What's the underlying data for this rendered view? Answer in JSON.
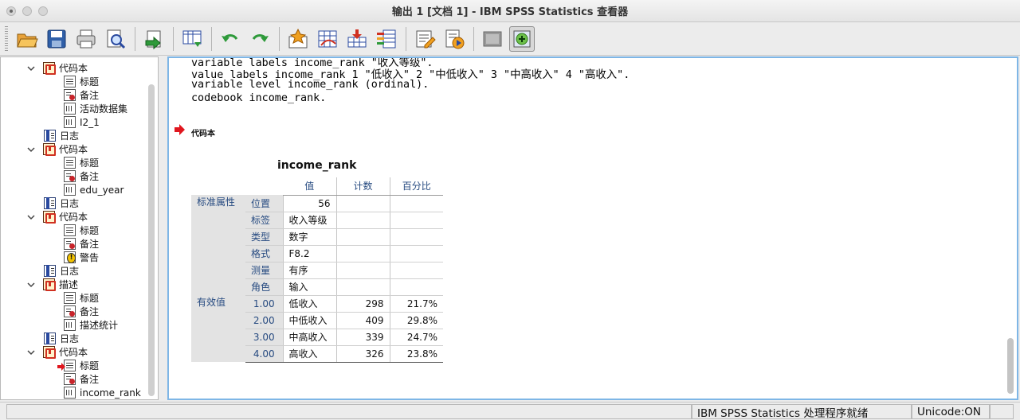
{
  "window": {
    "title": "输出 1 [文档 1] - IBM SPSS Statistics 查看器"
  },
  "toolbar": {
    "buttons": [
      "open-folder-icon",
      "save-icon",
      "print-icon",
      "print-preview-icon",
      "export-icon",
      "goto-data-icon",
      "undo-icon",
      "redo-icon",
      "goto-case-icon",
      "goto-variable-icon",
      "insert-cases-icon",
      "variables-icon",
      "designate-window-icon",
      "run-script-icon",
      "gray-box-icon",
      "add-output-icon"
    ]
  },
  "tree": {
    "items": [
      {
        "label": "代码本",
        "icon": "codebook-icon",
        "level": 1
      },
      {
        "label": "标题",
        "icon": "title-icon",
        "level": 2
      },
      {
        "label": "备注",
        "icon": "notes-icon",
        "level": 2
      },
      {
        "label": "活动数据集",
        "icon": "dataset-icon",
        "level": 2
      },
      {
        "label": "I2_1",
        "icon": "table-icon",
        "level": 2
      },
      {
        "label": "日志",
        "icon": "log-icon",
        "level": 1
      },
      {
        "label": "代码本",
        "icon": "codebook-icon",
        "level": 1
      },
      {
        "label": "标题",
        "icon": "title-icon",
        "level": 2
      },
      {
        "label": "备注",
        "icon": "notes-icon",
        "level": 2
      },
      {
        "label": "edu_year",
        "icon": "table-icon",
        "level": 2
      },
      {
        "label": "日志",
        "icon": "log-icon",
        "level": 1
      },
      {
        "label": "代码本",
        "icon": "codebook-icon",
        "level": 1
      },
      {
        "label": "标题",
        "icon": "title-icon",
        "level": 2
      },
      {
        "label": "备注",
        "icon": "notes-icon",
        "level": 2
      },
      {
        "label": "警告",
        "icon": "warning-icon",
        "level": 2
      },
      {
        "label": "日志",
        "icon": "log-icon",
        "level": 1
      },
      {
        "label": "描述",
        "icon": "codebook-icon",
        "level": 1
      },
      {
        "label": "标题",
        "icon": "title-icon",
        "level": 2
      },
      {
        "label": "备注",
        "icon": "notes-icon",
        "level": 2
      },
      {
        "label": "描述统计",
        "icon": "table-icon",
        "level": 2
      },
      {
        "label": "日志",
        "icon": "log-icon",
        "level": 1
      },
      {
        "label": "代码本",
        "icon": "codebook-icon",
        "level": 1
      },
      {
        "label": "标题",
        "icon": "title-icon",
        "level": 2
      },
      {
        "label": "备注",
        "icon": "notes-icon",
        "level": 2
      },
      {
        "label": "income_rank",
        "icon": "table-icon",
        "level": 2
      }
    ]
  },
  "syntax": {
    "line0": "variable labels income_rank \"收入等级\".",
    "line1": "value labels income_rank 1 \"低收入\" 2 \"中低收入\" 3 \"中高收入\" 4 \"高收入\".",
    "line2": "variable level income_rank (ordinal).",
    "line3": "codebook income_rank."
  },
  "output": {
    "section_title": "代码本",
    "table": {
      "title": "income_rank",
      "headers": [
        "值",
        "计数",
        "百分比"
      ],
      "group1": "标准属性",
      "group2": "有效值",
      "std_rows": [
        {
          "k": "位置",
          "v": "56"
        },
        {
          "k": "标签",
          "v": "收入等级"
        },
        {
          "k": "类型",
          "v": "数字"
        },
        {
          "k": "格式",
          "v": "F8.2"
        },
        {
          "k": "测量",
          "v": "有序"
        },
        {
          "k": "角色",
          "v": "输入"
        }
      ],
      "valid_rows": [
        {
          "k": "1.00",
          "v": "低收入",
          "count": "298",
          "pct": "21.7%"
        },
        {
          "k": "2.00",
          "v": "中低收入",
          "count": "409",
          "pct": "29.8%"
        },
        {
          "k": "3.00",
          "v": "中高收入",
          "count": "339",
          "pct": "24.7%"
        },
        {
          "k": "4.00",
          "v": "高收入",
          "count": "326",
          "pct": "23.8%"
        }
      ]
    }
  },
  "status": {
    "processor": "IBM SPSS Statistics 处理程序就绪",
    "unicode": "Unicode:ON"
  }
}
